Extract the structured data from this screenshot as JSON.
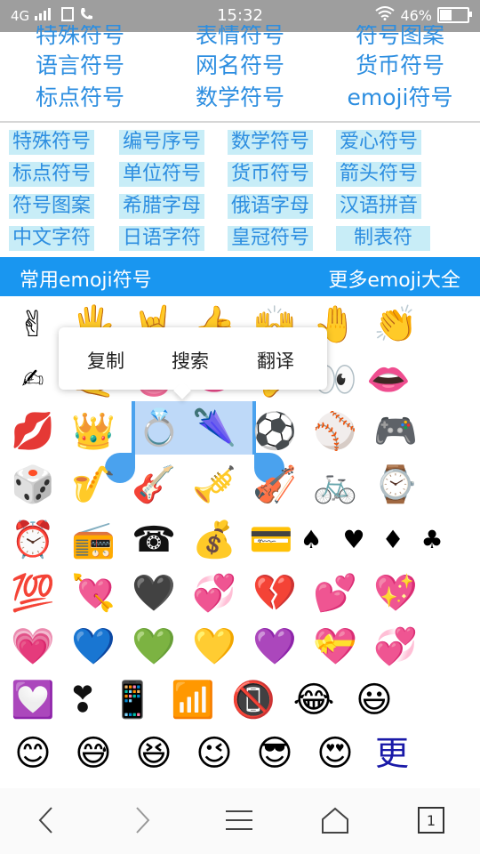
{
  "status_bar": {
    "network": "4G",
    "time": "15:32",
    "battery": "46%"
  },
  "top_links": [
    [
      "特殊符号",
      "表情符号",
      "符号图案"
    ],
    [
      "语言符号",
      "网名符号",
      "货币符号"
    ],
    [
      "标点符号",
      "数学符号",
      "emoji符号"
    ]
  ],
  "tags": [
    [
      "特殊符号",
      "编号序号",
      "数学符号",
      "爱心符号"
    ],
    [
      "标点符号",
      "单位符号",
      "货币符号",
      "箭头符号"
    ],
    [
      "符号图案",
      "希腊字母",
      "俄语字母",
      "汉语拼音"
    ],
    [
      "中文字符",
      "日语字符",
      "皇冠符号",
      "制表符"
    ]
  ],
  "section_header": {
    "title": "常用emoji符号",
    "more_link": "更多emoji大全"
  },
  "context_menu": {
    "copy": "复制",
    "search": "搜索",
    "translate": "翻译"
  },
  "emoji_grid": [
    [
      "✌",
      "🖐",
      "🤘",
      "👍",
      "🙌",
      "🤚",
      "👏"
    ],
    [
      "✍",
      "🤙",
      "👅",
      "👄",
      "👂",
      "👀",
      "👄"
    ],
    [
      "💋",
      "👑",
      "💍",
      "🌂",
      "⚽",
      "⚾",
      "🎮"
    ],
    [
      "🎲",
      "🎷",
      "🎸",
      "🎺",
      "🎻",
      "🚲",
      "⌚"
    ],
    [
      "⏰",
      "📻",
      "☎",
      "💰",
      "💳",
      "♠",
      "♥",
      "♦",
      "♣"
    ],
    [
      "💯",
      "💘",
      "🖤",
      "💞",
      "💔",
      "💕",
      "💖"
    ],
    [
      "💗",
      "💙",
      "💚",
      "💛",
      "💜",
      "💝",
      "💞"
    ],
    [
      "💟",
      "❣",
      "📱",
      "📶",
      "📵",
      "😂",
      "😃"
    ],
    [
      "😊",
      "😅",
      "😆",
      "😉",
      "😎",
      "😍",
      "更"
    ]
  ],
  "nav": {
    "back_icon": "chevron-left",
    "forward_icon": "chevron-right",
    "menu_icon": "hamburger",
    "home_icon": "home",
    "tabs_count": "1"
  }
}
